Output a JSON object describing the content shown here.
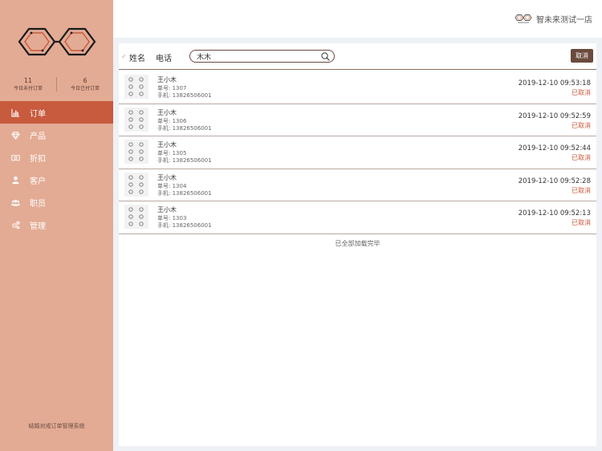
{
  "sidebar": {
    "stats": [
      {
        "value": "11",
        "label": "今日未付订单"
      },
      {
        "value": "6",
        "label": "今日已付订单"
      }
    ],
    "menu": [
      {
        "label": "订单",
        "icon": "bar-chart-icon",
        "active": true
      },
      {
        "label": "产品",
        "icon": "diamond-icon",
        "active": false
      },
      {
        "label": "折扣",
        "icon": "money-icon",
        "active": false
      },
      {
        "label": "客户",
        "icon": "user-icon",
        "active": false
      },
      {
        "label": "职员",
        "icon": "users-icon",
        "active": false
      },
      {
        "label": "管理",
        "icon": "gears-icon",
        "active": false
      }
    ],
    "footer": "结婚对戒订单管理系统"
  },
  "header": {
    "store_name": "智未来测试一店"
  },
  "filters": {
    "options": [
      "姓名",
      "电话"
    ],
    "selected": "姓名",
    "search_value": "木木",
    "cancel_label": "取消"
  },
  "orders": [
    {
      "name": "王小木",
      "order_no": "单号: 1307",
      "phone": "手机: 13826506001",
      "time": "2019-12-10 09:53:18",
      "status": "已取消"
    },
    {
      "name": "王小木",
      "order_no": "单号: 1306",
      "phone": "手机: 13826506001",
      "time": "2019-12-10 09:52:59",
      "status": "已取消"
    },
    {
      "name": "王小木",
      "order_no": "单号: 1305",
      "phone": "手机: 13826506001",
      "time": "2019-12-10 09:52:44",
      "status": "已取消"
    },
    {
      "name": "王小木",
      "order_no": "单号: 1304",
      "phone": "手机: 13826506001",
      "time": "2019-12-10 09:52:28",
      "status": "已取消"
    },
    {
      "name": "王小木",
      "order_no": "单号: 1303",
      "phone": "手机: 13826506001",
      "time": "2019-12-10 09:52:13",
      "status": "已取消"
    }
  ],
  "list_end_text": "已全部加载完毕",
  "colors": {
    "sidebar": "#e3ab94",
    "active_menu": "#c85a3d",
    "accent_dark": "#6b4a3e",
    "status_cancelled": "#c85a3d"
  }
}
